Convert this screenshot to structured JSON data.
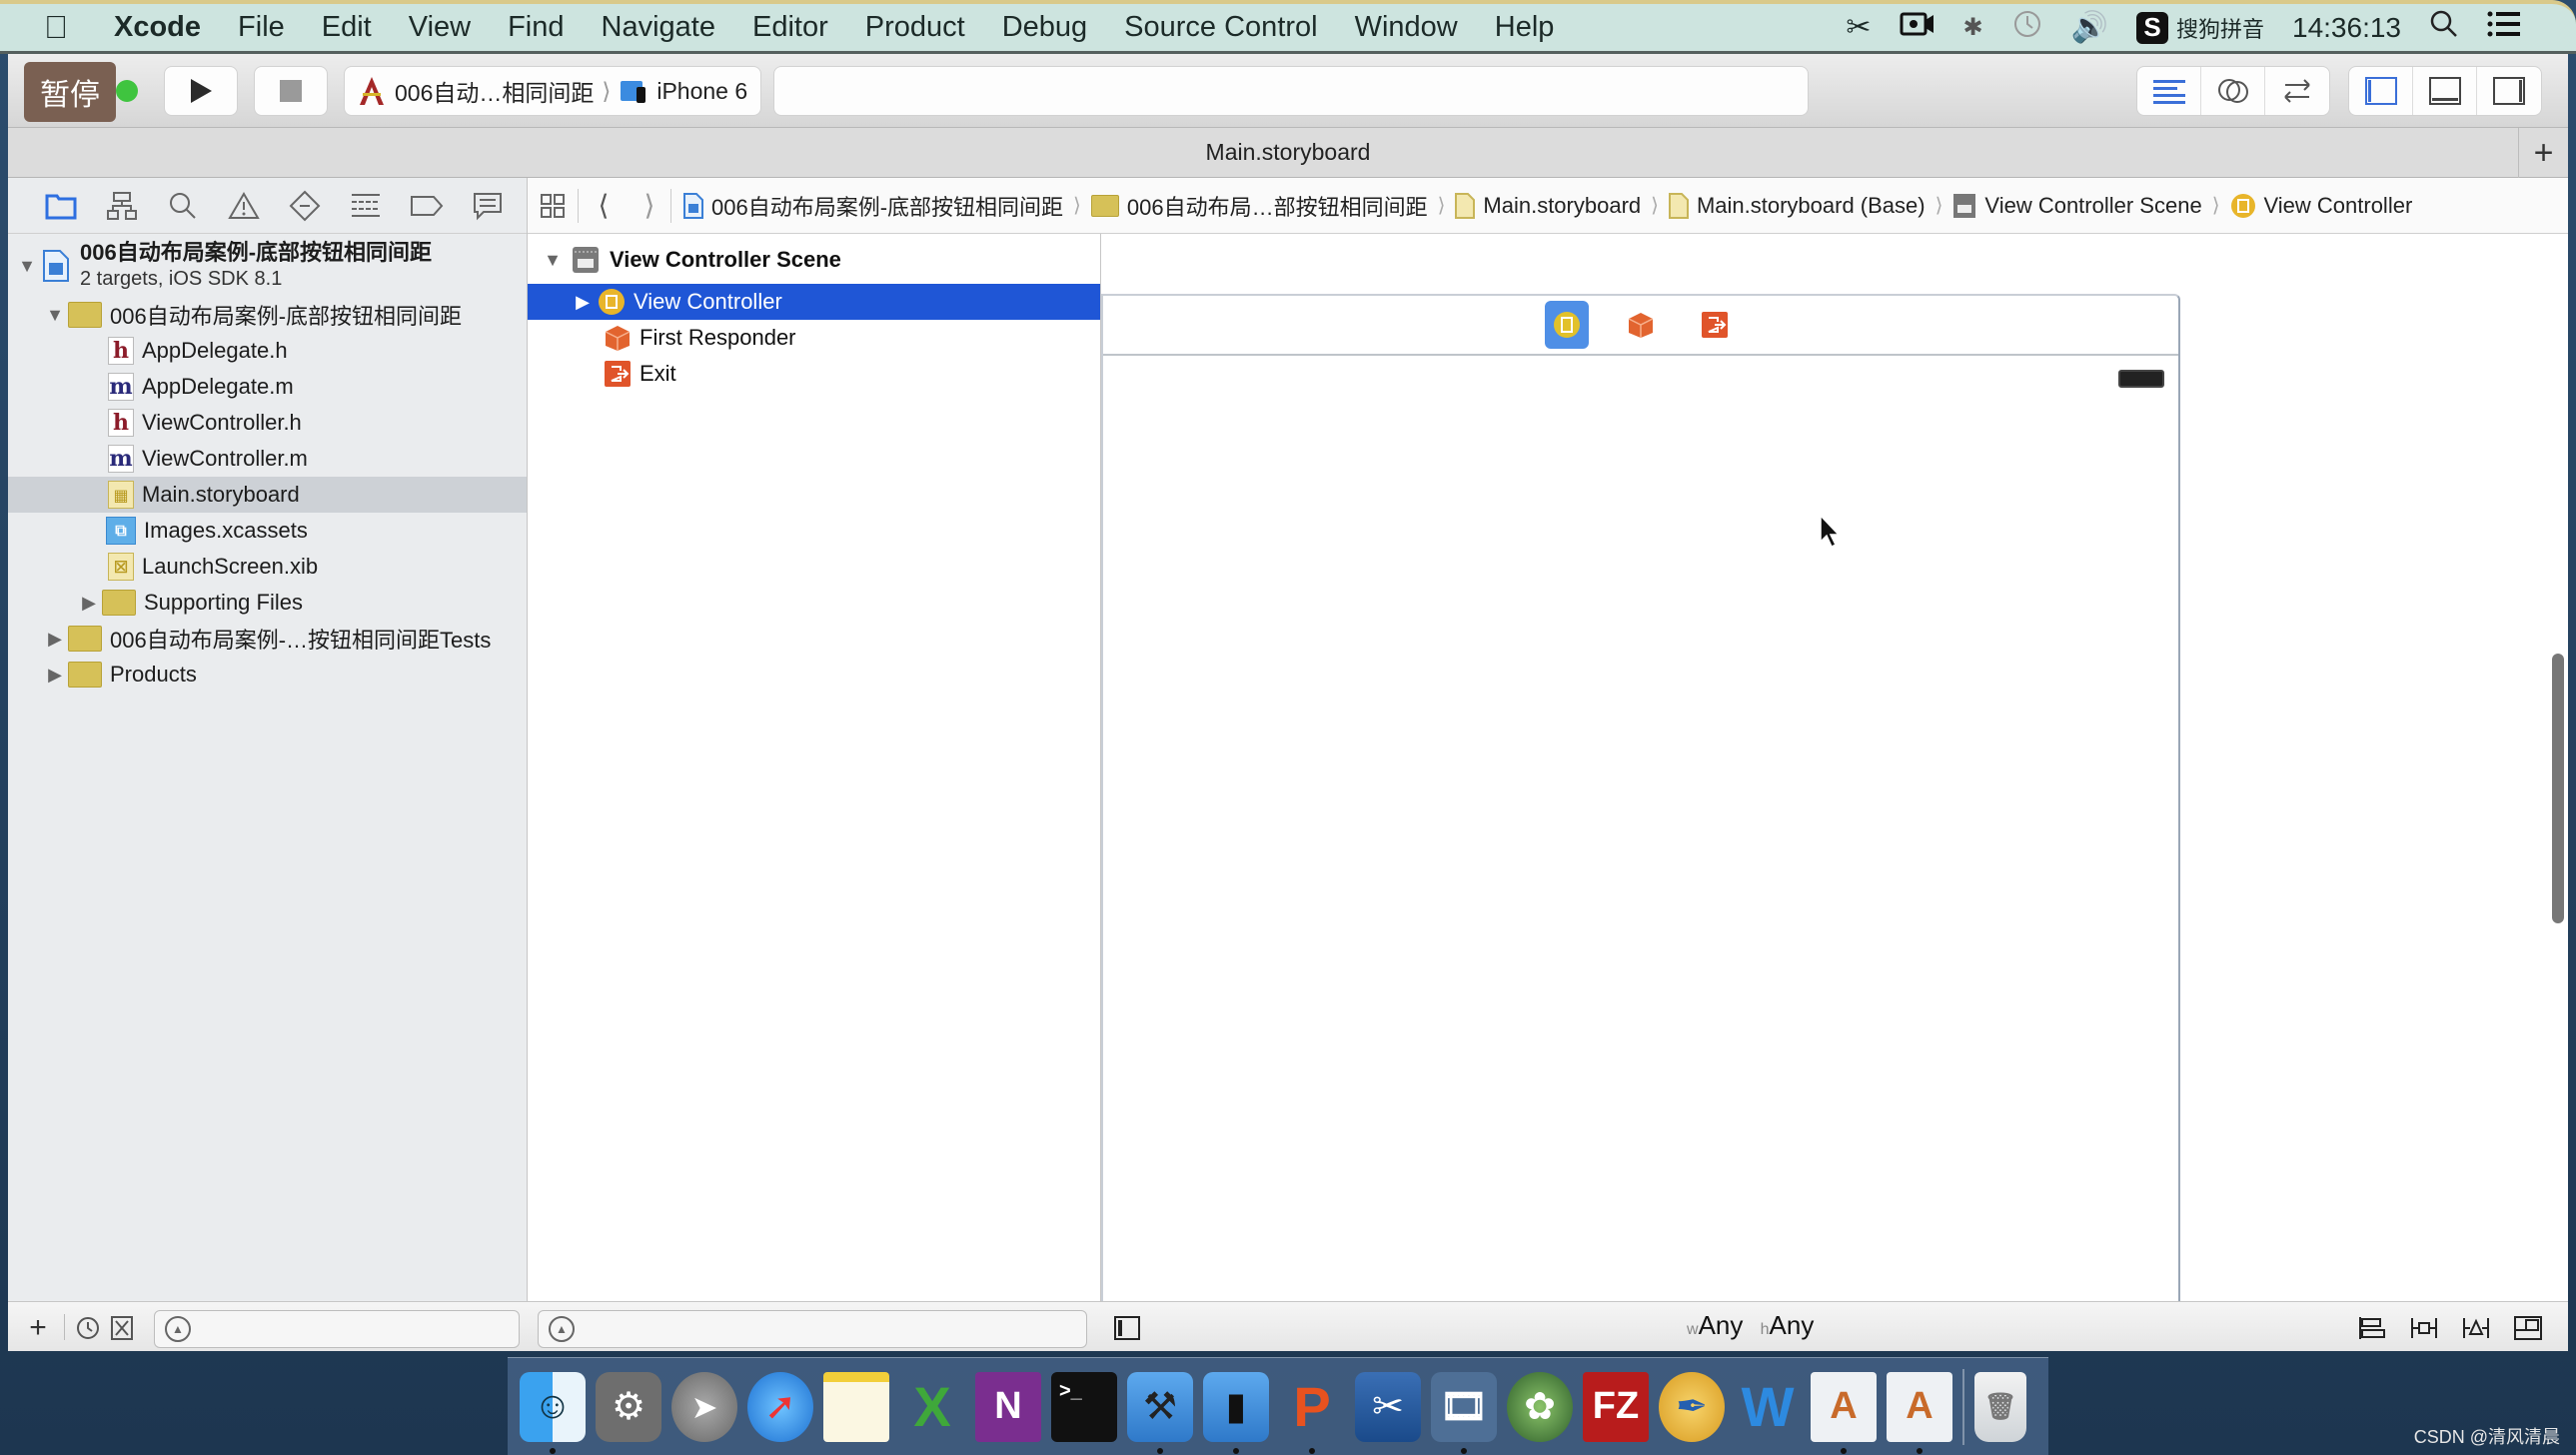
{
  "menubar": {
    "app_name": "Xcode",
    "items": [
      "File",
      "Edit",
      "View",
      "Find",
      "Navigate",
      "Editor",
      "Product",
      "Debug",
      "Source Control",
      "Window",
      "Help"
    ],
    "status_icons": [
      "scissors-icon",
      "screen-record-icon",
      "bluetooth-icon",
      "time-machine-icon",
      "volume-icon"
    ],
    "input_method": "搜狗拼音",
    "clock": "14:36:13"
  },
  "toolbar": {
    "pause_badge": "暂停",
    "scheme": "006自动…相同间距",
    "destination": "iPhone 6",
    "activity_text": ""
  },
  "tab": {
    "title": "Main.storyboard"
  },
  "navigator": {
    "icons": [
      "project-navigator-icon",
      "symbol-navigator-icon",
      "find-navigator-icon",
      "issue-navigator-icon",
      "test-navigator-icon",
      "debug-navigator-icon",
      "breakpoint-navigator-icon",
      "report-navigator-icon"
    ],
    "project": {
      "name": "006自动布局案例-底部按钮相同间距",
      "subtitle": "2 targets, iOS SDK 8.1"
    },
    "items": [
      {
        "label": "006自动布局案例-底部按钮相同间距",
        "type": "folder",
        "expanded": true
      },
      {
        "label": "AppDelegate.h",
        "type": "h"
      },
      {
        "label": "AppDelegate.m",
        "type": "m"
      },
      {
        "label": "ViewController.h",
        "type": "h"
      },
      {
        "label": "ViewController.m",
        "type": "m"
      },
      {
        "label": "Main.storyboard",
        "type": "storyboard",
        "selected": true
      },
      {
        "label": "Images.xcassets",
        "type": "xcassets"
      },
      {
        "label": "LaunchScreen.xib",
        "type": "xib"
      },
      {
        "label": "Supporting Files",
        "type": "folder",
        "expanded": false
      },
      {
        "label": "006自动布局案例-…按钮相同间距Tests",
        "type": "folder",
        "expanded": false
      },
      {
        "label": "Products",
        "type": "folder",
        "expanded": false
      }
    ]
  },
  "jumpbar": {
    "crumbs": [
      "006自动布局案例-底部按钮相同间距",
      "006自动布局…部按钮相同间距",
      "Main.storyboard",
      "Main.storyboard (Base)",
      "View Controller Scene",
      "View Controller"
    ]
  },
  "outline": {
    "scene": "View Controller Scene",
    "items": [
      {
        "label": "View Controller",
        "selected": true
      },
      {
        "label": "First Responder"
      },
      {
        "label": "Exit"
      }
    ]
  },
  "canvas": {
    "size_class_w_prefix": "w",
    "size_class_w": "Any",
    "size_class_h_prefix": "h",
    "size_class_h": "Any"
  },
  "colors": {
    "selection": "#1f56d6",
    "menubar": "#cde4df",
    "folder": "#d6c158"
  },
  "dock": {
    "apps": [
      "Finder",
      "System Preferences",
      "Launchpad",
      "Safari",
      "Notes",
      "Excel",
      "OneNote",
      "Terminal",
      "Xcode",
      "iOS Simulator",
      "PowerPoint",
      "Screenshot",
      "Video",
      "Vypo",
      "FileZilla",
      "Sketch",
      "Word",
      "Instruments A",
      "Instruments B",
      "Trash"
    ]
  },
  "watermark": "CSDN @清风清晨"
}
